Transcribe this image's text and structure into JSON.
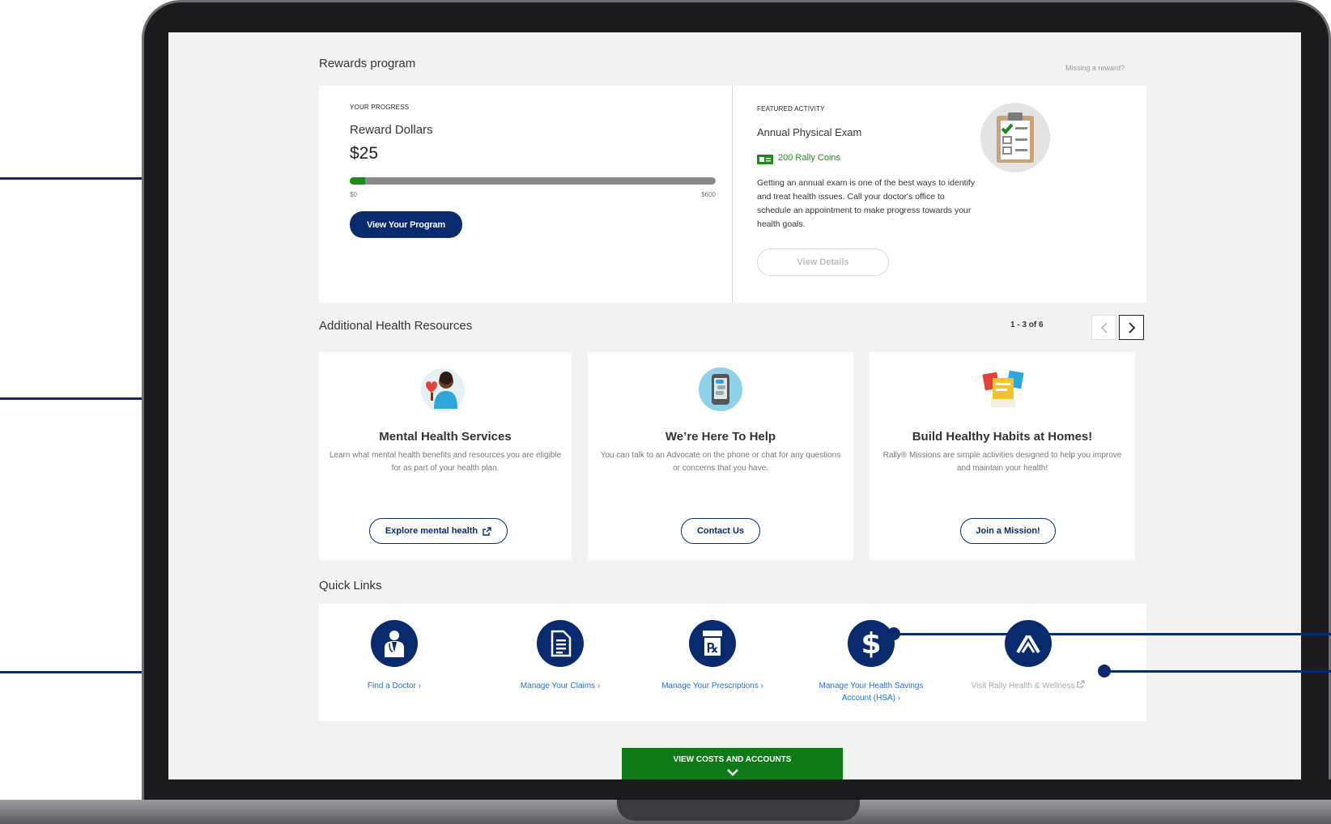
{
  "rewards": {
    "section_title": "Rewards program",
    "missing_link": "Missing a reward?",
    "progress": {
      "caption": "YOUR PROGRESS",
      "title": "Reward Dollars",
      "amount": "$25",
      "min_label": "$0",
      "max_label": "$600",
      "progress_fraction": 0.0417,
      "button_label": "View Your Program"
    },
    "featured": {
      "caption": "FEATURED ACTIVITY",
      "title": "Annual Physical Exam",
      "coins": "200 Rally Coins",
      "description": "Getting an annual exam is one of the best ways to identify and treat health issues. Call your doctor's office to schedule an appointment to make progress towards your health goals.",
      "button_label": "View Details",
      "icon": "clipboard-checklist-icon"
    }
  },
  "resources": {
    "section_title": "Additional Health Resources",
    "pager_text": "1 - 3 of 6",
    "cards": [
      {
        "title": "Mental Health Services",
        "description": "Learn what mental health benefits and resources you are eligible for as part of your health plan.",
        "button_label": "Explore mental health",
        "icon": "person-heart-icon"
      },
      {
        "title": "We’re Here To Help",
        "description": "You can talk to an Advocate on the phone or chat for any questions or concerns that you have.",
        "button_label": "Contact Us",
        "icon": "phone-chat-icon"
      },
      {
        "title": "Build Healthy Habits at Homes!",
        "description": "Rally® Missions are simple activities designed to help you improve and maintain your health!",
        "button_label": "Join a Mission!",
        "icon": "mission-cards-icon"
      }
    ]
  },
  "quick_links": {
    "section_title": "Quick Links",
    "items": [
      {
        "label": "Find a Doctor ›",
        "icon": "doctor-icon"
      },
      {
        "label": "Manage Your Claims ›",
        "icon": "document-icon"
      },
      {
        "label": "Manage Your Prescriptions ›",
        "icon": "prescription-icon"
      },
      {
        "label": "Manage Your Health Savings Account (HSA) ›",
        "icon": "dollar-icon"
      },
      {
        "label": "Visit Rally Health & Wellness",
        "icon": "rally-logo-icon"
      }
    ]
  },
  "footer_bar": {
    "label": "VIEW COSTS AND ACCOUNTS",
    "icon": "chevron-down-icon"
  },
  "colors": {
    "navy": "#0a2a6e",
    "green": "#1c8a1c",
    "link_blue": "#1f6fd0",
    "screen_bg": "#f2f2f2"
  }
}
